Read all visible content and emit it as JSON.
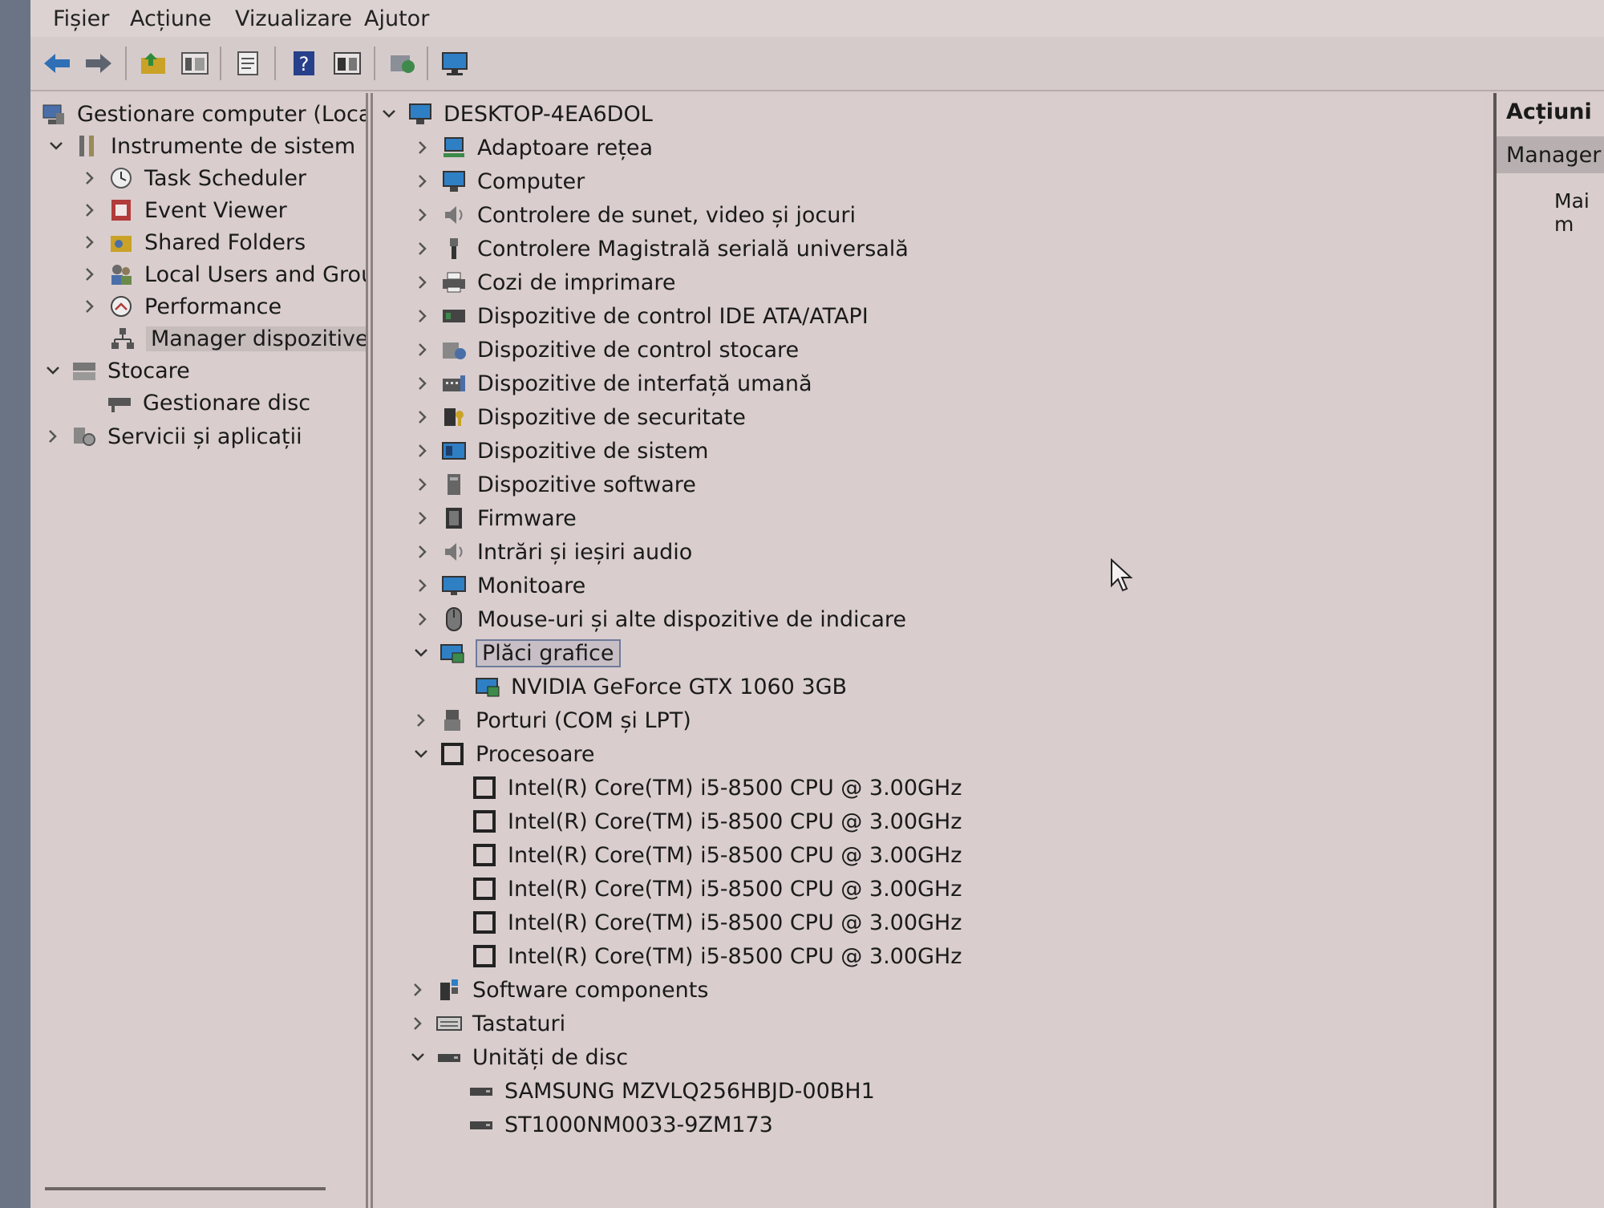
{
  "menu": [
    "Fișier",
    "Acțiune",
    "Vizualizare",
    "Ajutor"
  ],
  "left_tree": {
    "root": "Gestionare computer (Local)",
    "system_tools": "Instrumente de sistem",
    "task_scheduler": "Task Scheduler",
    "event_viewer": "Event Viewer",
    "shared_folders": "Shared Folders",
    "local_users": "Local Users and Groups",
    "performance": "Performance",
    "device_manager": "Manager dispozitive",
    "storage": "Stocare",
    "disk_management": "Gestionare disc",
    "services": "Servicii și aplicații"
  },
  "device_tree": {
    "computer_name": "DESKTOP-4EA6DOL",
    "categories": [
      "Adaptoare rețea",
      "Computer",
      "Controlere de sunet, video și jocuri",
      "Controlere Magistrală serială universală",
      "Cozi de imprimare",
      "Dispozitive de control IDE ATA/ATAPI",
      "Dispozitive de control stocare",
      "Dispozitive de interfață umană",
      "Dispozitive de securitate",
      "Dispozitive de sistem",
      "Dispozitive software",
      "Firmware",
      "Intrări și ieșiri audio",
      "Monitoare",
      "Mouse-uri și alte dispozitive de indicare"
    ],
    "graphics": "Plăci grafice",
    "gpu": "NVIDIA GeForce GTX 1060 3GB",
    "ports": "Porturi (COM și LPT)",
    "processors": "Procesoare",
    "cpus": [
      "Intel(R) Core(TM) i5-8500 CPU @ 3.00GHz",
      "Intel(R) Core(TM) i5-8500 CPU @ 3.00GHz",
      "Intel(R) Core(TM) i5-8500 CPU @ 3.00GHz",
      "Intel(R) Core(TM) i5-8500 CPU @ 3.00GHz",
      "Intel(R) Core(TM) i5-8500 CPU @ 3.00GHz",
      "Intel(R) Core(TM) i5-8500 CPU @ 3.00GHz"
    ],
    "software_components": "Software components",
    "keyboards": "Tastaturi",
    "disk_drives": "Unități de disc",
    "disks": [
      "SAMSUNG MZVLQ256HBJD-00BH1",
      "ST1000NM0033-9ZM173"
    ]
  },
  "actions": {
    "title": "Acțiuni",
    "subhead": "Manager",
    "more": "Mai m"
  }
}
